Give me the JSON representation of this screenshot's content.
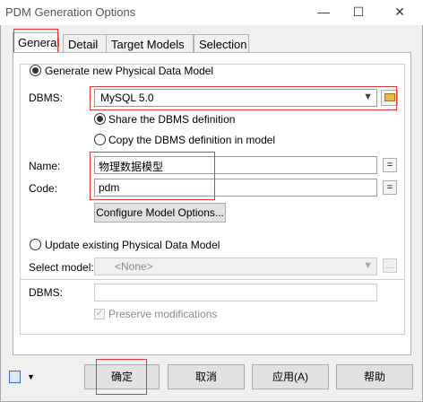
{
  "window": {
    "title": "PDM Generation Options",
    "minimize_glyph": "—",
    "maximize_glyph": "☐",
    "close_glyph": "✕"
  },
  "tabs": [
    {
      "label": "General",
      "active": true
    },
    {
      "label": "Detail",
      "active": false
    },
    {
      "label": "Target Models",
      "active": false
    },
    {
      "label": "Selection",
      "active": false
    }
  ],
  "generate_new": {
    "label": "Generate new Physical Data Model",
    "dbms_label": "DBMS:",
    "dbms_value": "MySQL 5.0",
    "share_label": "Share the DBMS definition",
    "copy_label": "Copy the DBMS definition in model",
    "name_label": "Name:",
    "name_value": "物理数据模型",
    "code_label": "Code:",
    "code_value": "pdm",
    "eq_glyph": "=",
    "configure_label": "Configure Model Options..."
  },
  "update_existing": {
    "label": "Update existing Physical Data Model",
    "select_label": "Select model:",
    "select_value": "<None>",
    "dbms_label": "DBMS:",
    "dbms_value": "",
    "preserve_label": "Preserve modifications",
    "dots_glyph": "..."
  },
  "footer": {
    "ok": "确定",
    "cancel": "取消",
    "apply": "应用(A)",
    "help": "帮助"
  },
  "colors": {
    "highlight": "#e03a3a",
    "folder": "#e8b84a"
  },
  "icons": [
    "window-menu-icon",
    "dropdown-arrow-icon",
    "folder-icon"
  ]
}
